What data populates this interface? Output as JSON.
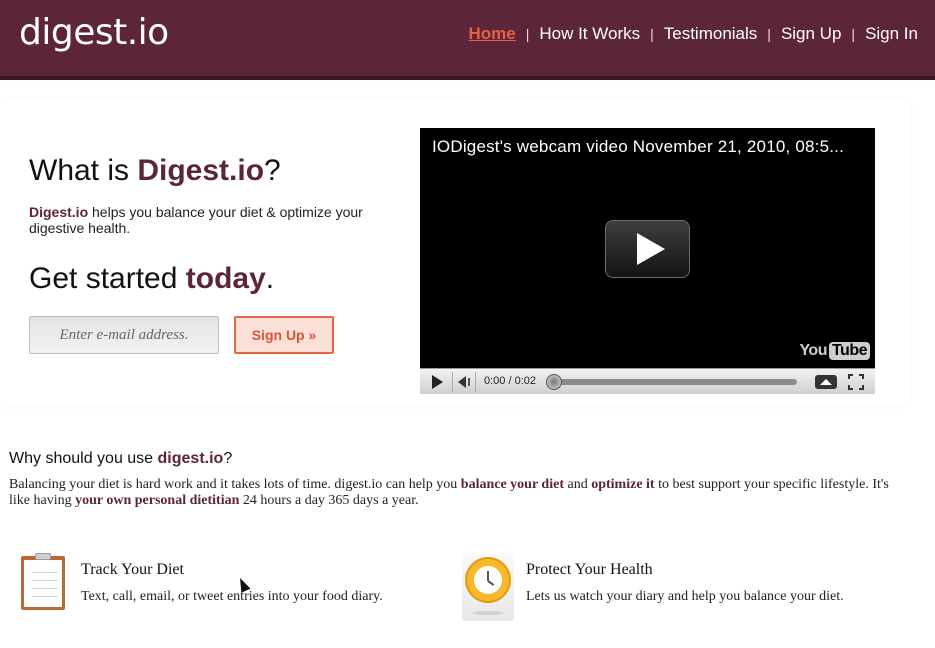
{
  "header": {
    "logo": "digest.io",
    "nav": [
      {
        "label": "Home",
        "active": true
      },
      {
        "label": "How It Works",
        "active": false
      },
      {
        "label": "Testimonials",
        "active": false
      },
      {
        "label": "Sign Up",
        "active": false
      },
      {
        "label": "Sign In",
        "active": false
      }
    ],
    "separator": "|"
  },
  "hero": {
    "what_prefix": "What is ",
    "what_brand": "Digest.io",
    "what_suffix": "?",
    "desc_brand": "Digest.io",
    "desc_text": " helps you balance your diet & optimize your digestive health.",
    "get_prefix": "Get started ",
    "get_highlight": "today",
    "get_suffix": ".",
    "email_placeholder": "Enter e-mail address.",
    "signup_button": "Sign Up »"
  },
  "video": {
    "title": "IODigest's webcam video November 21, 2010, 08:5...",
    "time": "0:00 / 0:02",
    "logo_you": "You",
    "logo_tube": "Tube",
    "progress": 0
  },
  "why": {
    "title_prefix": "Why should you use ",
    "title_brand": "digest.io",
    "title_suffix": "?",
    "p1": "Balancing your diet is hard work and it takes lots of time. digest.io can help you ",
    "h1": "balance your diet",
    "p2": " and ",
    "h2": "optimize it",
    "p3": " to best support your specific lifestyle. It's like having ",
    "h3": "your own personal dietitian",
    "p4": " 24 hours a day 365 days a year."
  },
  "features": [
    {
      "title": "Track Your Diet",
      "desc": "Text, call, email, or tweet entries into your food diary.",
      "icon": "clipboard-icon"
    },
    {
      "title": "Protect Your Health",
      "desc": "Lets us watch your diary and help you balance your diet.",
      "icon": "stopwatch-icon"
    }
  ],
  "colors": {
    "brand": "#5c2539",
    "accent": "#e8613f"
  }
}
